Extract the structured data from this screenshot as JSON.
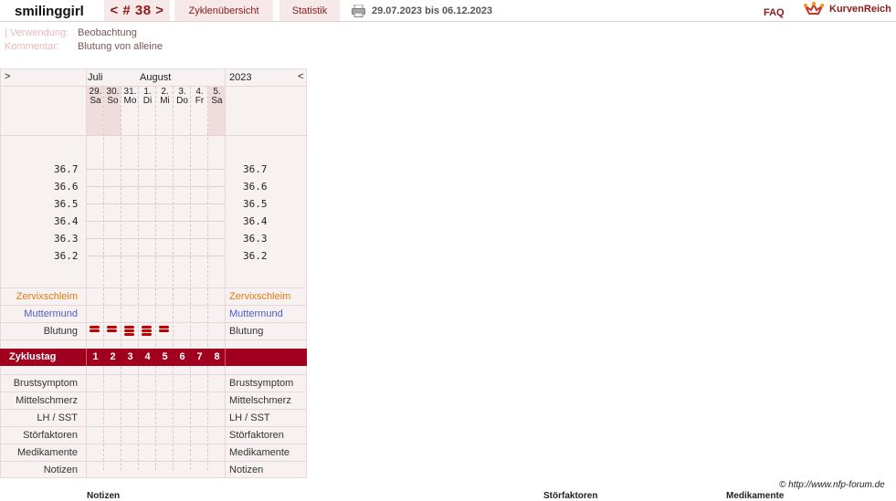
{
  "header": {
    "username": "smilinggirl",
    "cycle_nav": "< # 38 >",
    "tab_cycles": "Zyklenübersicht",
    "tab_stats": "Statistik",
    "date_range": "29.07.2023 bis 06.12.2023",
    "faq": "FAQ",
    "brand": "KurvenReich"
  },
  "meta": {
    "usage_label": "| Verwendung:",
    "usage_value": "Beobachtung",
    "comment_label": "Kommentar:",
    "comment_value": "Blutung von alleine"
  },
  "chart": {
    "nav_left": ">",
    "nav_right": "<",
    "month1": "Juli",
    "month2": "August",
    "year": "2023",
    "days": [
      {
        "num": "29.",
        "wd": "Sa"
      },
      {
        "num": "30.",
        "wd": "So"
      },
      {
        "num": "31.",
        "wd": "Mo"
      },
      {
        "num": "1.",
        "wd": "Di"
      },
      {
        "num": "2.",
        "wd": "Mi"
      },
      {
        "num": "3.",
        "wd": "Do"
      },
      {
        "num": "4.",
        "wd": "Fr"
      },
      {
        "num": "5.",
        "wd": "Sa"
      }
    ],
    "temps_left": [
      "36.7",
      "36.6",
      "36.5",
      "36.4",
      "36.3",
      "36.2"
    ],
    "temps_right": [
      "36.7",
      "36.6",
      "36.5",
      "36.4",
      "36.3",
      "36.2"
    ],
    "row_cervix": "Zervixschleim",
    "row_cervix_color": "#e07a10",
    "row_cervix_pos": "Muttermund",
    "row_cervix_pos_color": "#4a5fc8",
    "row_bleeding": "Blutung",
    "bleeding_levels": [
      2,
      2,
      3,
      3,
      2,
      0,
      0,
      0
    ],
    "cycle_day_label": "Zyklustag",
    "cycle_days": [
      "1",
      "2",
      "3",
      "4",
      "5",
      "6",
      "7",
      "8"
    ],
    "row_breast": "Brustsymptom",
    "row_midpain": "Mittelschmerz",
    "row_lh": "LH / SST",
    "row_disturb": "Störfaktoren",
    "row_meds": "Medikamente",
    "row_notes": "Notizen",
    "accent": "#a0001e"
  },
  "footer": {
    "credit": "© http://www.nfp-forum.de",
    "bottom_notes": "Notizen",
    "bottom_disturb": "Störfaktoren",
    "bottom_meds": "Medikamente"
  }
}
